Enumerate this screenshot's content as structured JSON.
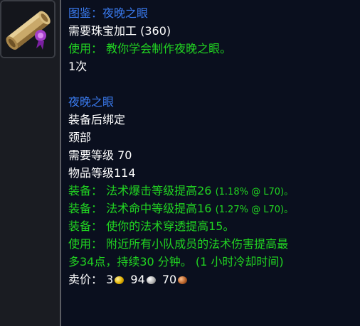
{
  "icon": {
    "name": "recipe-scroll-icon"
  },
  "colors": {
    "title_blue": "#3a7bf0",
    "effect_green": "#21d421",
    "text_white": "#ffffff",
    "tooltip_bg": "#0a0f1e"
  },
  "recipe": {
    "title": "图鉴：夜晚之眼",
    "requirement": "需要珠宝加工 (360)",
    "use_label": "使用：",
    "use_text": "教你学会制作夜晚之眼。",
    "charges": "1次"
  },
  "item": {
    "name": "夜晚之眼",
    "binding": "装备后绑定",
    "slot": "颈部",
    "required_level": "需要等级 70",
    "item_level": "物品等级114",
    "equip1_label": "装备：",
    "equip1_text": "法术爆击等级提高26",
    "equip1_note": "(1.18% @ L70)。",
    "equip2_label": "装备：",
    "equip2_text": "法术命中等级提高16",
    "equip2_note": "(1.27% @ L70)。",
    "equip3_label": "装备：",
    "equip3_text": "使你的法术穿透提高15。",
    "use_label": "使用：",
    "use_line1": "附近所有小队成员的法术伤害提高最",
    "use_line2": "多34点，持续30 分钟。 (1 小时冷却时间)",
    "sell_label": "卖价：",
    "sell_gold": "3",
    "sell_silver": "94",
    "sell_copper": "70"
  }
}
